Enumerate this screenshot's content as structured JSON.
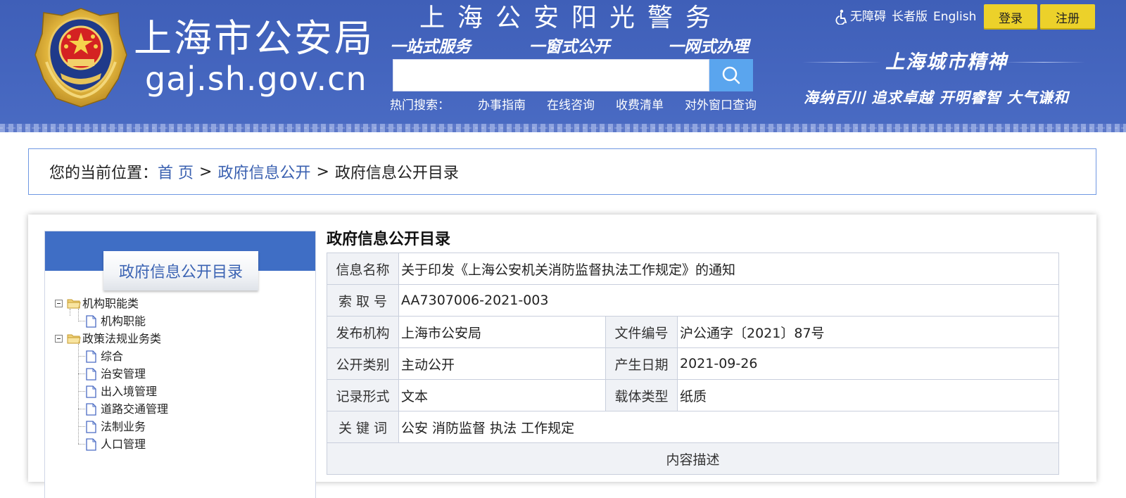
{
  "header": {
    "logo_text_cn": "上海市公安局",
    "logo_text_url": "gaj.sh.gov.cn",
    "slogan_main": "上海公安阳光警务",
    "slogan_sub": [
      "一站式服务",
      "一窗式公开",
      "一网式办理"
    ],
    "search": {
      "placeholder": "",
      "button_icon": "search-icon"
    },
    "hot_search_label": "热门搜索：",
    "hot_links": [
      "办事指南",
      "在线咨询",
      "收费清单",
      "对外窗口查询"
    ],
    "top_links": {
      "accessibility": "无障碍",
      "elder": "长者版",
      "english": "English"
    },
    "login_label": "登录",
    "register_label": "注册",
    "city_spirit_title": "上海城市精神",
    "city_spirit_motto": "海纳百川 追求卓越 开明睿智 大气谦和"
  },
  "breadcrumb": {
    "label": "您的当前位置：",
    "items": [
      "首 页",
      "政府信息公开"
    ],
    "separator": ">",
    "current": "政府信息公开目录"
  },
  "sidebar": {
    "title": "政府信息公开目录",
    "tree": [
      {
        "label": "机构职能类",
        "children": [
          "机构职能"
        ]
      },
      {
        "label": "政策法规业务类",
        "children": [
          "综合",
          "治安管理",
          "出入境管理",
          "道路交通管理",
          "法制业务",
          "人口管理"
        ]
      }
    ]
  },
  "info": {
    "title": "政府信息公开目录",
    "rows": {
      "name": {
        "key": "信息名称",
        "value": "关于印发《上海公安机关消防监督执法工作规定》的通知"
      },
      "index": {
        "key": "索 取 号",
        "value": "AA7307006-2021-003"
      },
      "publisher": {
        "key": "发布机构",
        "value": "上海市公安局"
      },
      "doc_no": {
        "key": "文件编号",
        "value": "沪公通字〔2021〕87号"
      },
      "category": {
        "key": "公开类别",
        "value": "主动公开"
      },
      "date": {
        "key": "产生日期",
        "value": "2021-09-26"
      },
      "format": {
        "key": "记录形式",
        "value": "文本"
      },
      "carrier": {
        "key": "载体类型",
        "value": "纸质"
      },
      "keywords": {
        "key": "关 键 词",
        "value": "公安 消防监督 执法 工作规定"
      },
      "description": {
        "key": "内容描述"
      }
    }
  },
  "colors": {
    "header_bg": "#4566bf",
    "accent_yellow": "#ecd12a",
    "link_blue": "#3a60b0",
    "search_btn": "#5aa5ee"
  }
}
